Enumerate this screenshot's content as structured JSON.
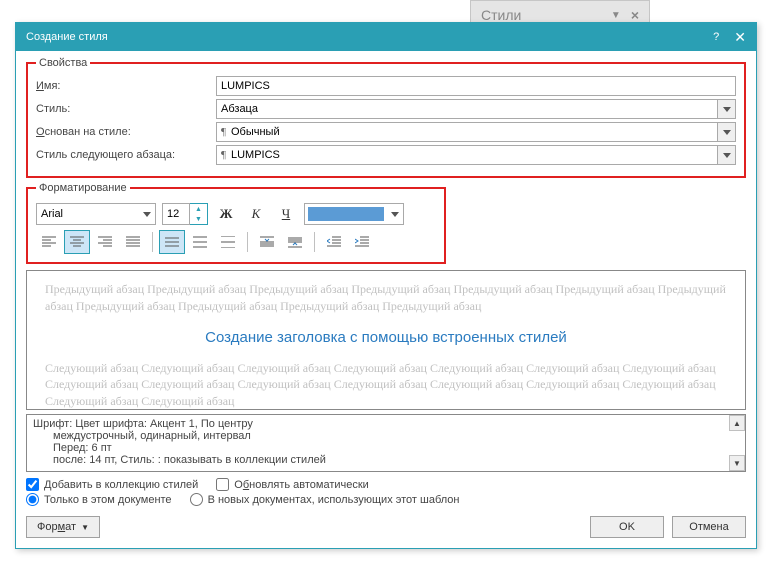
{
  "background_tab": {
    "title": "Стили",
    "arrow": "▼",
    "close": "×"
  },
  "dialog": {
    "title": "Создание стиля",
    "help": "?",
    "close": "✕"
  },
  "props": {
    "legend": "Свойства",
    "name_label": "Имя:",
    "name_value": "LUMPICS",
    "style_label": "Стиль:",
    "style_value": "Абзаца",
    "based_label": "Основан на стиле:",
    "based_value": "Обычный",
    "next_label": "Стиль следующего абзаца:",
    "next_value": "LUMPICS"
  },
  "formatting": {
    "legend": "Форматирование",
    "font": "Arial",
    "size": "12",
    "bold": "Ж",
    "italic": "К",
    "underline": "Ч",
    "color": "#5b9bd5"
  },
  "preview": {
    "prev_para": "Предыдущий абзац Предыдущий абзац Предыдущий абзац Предыдущий абзац Предыдущий абзац Предыдущий абзац Предыдущий абзац Предыдущий абзац Предыдущий абзац Предыдущий абзац Предыдущий абзац",
    "sample": "Создание заголовка с помощью встроенных стилей",
    "next_para": "Следующий абзац Следующий абзац Следующий абзац Следующий абзац Следующий абзац Следующий абзац Следующий абзац Следующий абзац Следующий абзац Следующий абзац Следующий абзац Следующий абзац Следующий абзац Следующий абзац Следующий абзац Следующий абзац"
  },
  "desc": {
    "l1": "Шрифт: Цвет шрифта: Акцент 1, По центру",
    "l2": "междустрочный,  одинарный, интервал",
    "l3": "Перед:  6 пт",
    "l4": "после:  14 пт, Стиль: : показывать в коллекции стилей"
  },
  "checks": {
    "add": "Добавить в коллекцию стилей",
    "auto": "Обновлять автоматически",
    "doc_only": "Только в этом документе",
    "templates": "В новых документах, использующих этот шаблон"
  },
  "buttons": {
    "format": "Формат",
    "ok": "OK",
    "cancel": "Отмена"
  }
}
